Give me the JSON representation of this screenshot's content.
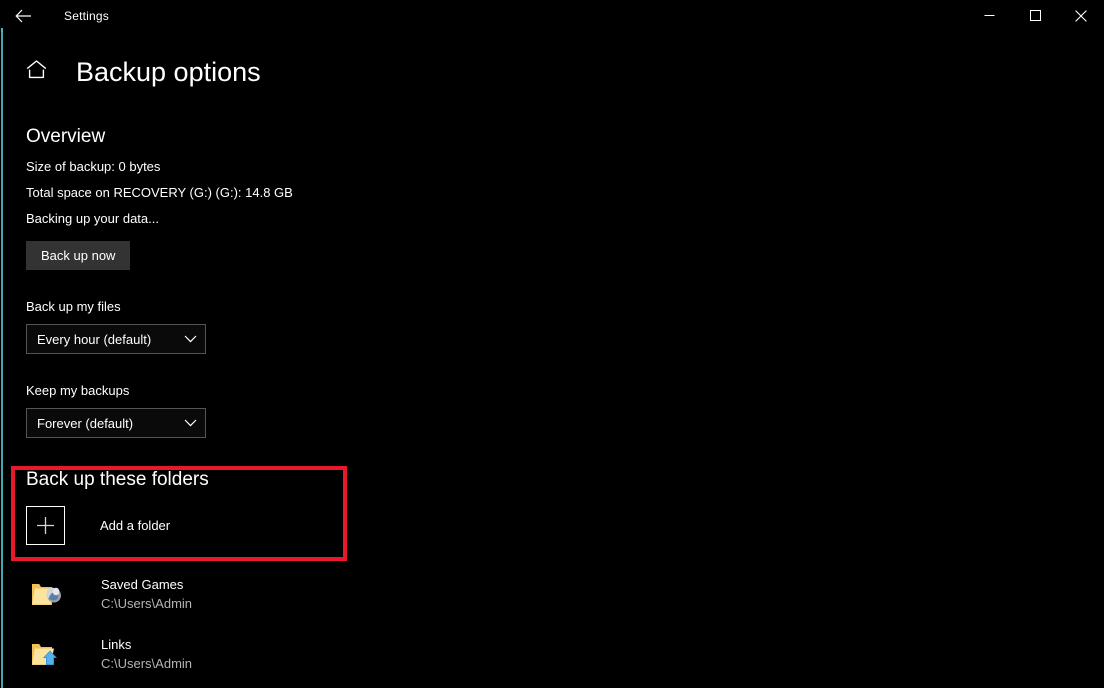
{
  "window": {
    "title": "Settings",
    "back_icon": "back-arrow-icon",
    "minimize_icon": "minimize-icon",
    "maximize_icon": "maximize-icon",
    "close_icon": "close-icon"
  },
  "header": {
    "home_icon": "home-icon",
    "page_title": "Backup options"
  },
  "overview": {
    "heading": "Overview",
    "size_of_backup": "Size of backup: 0 bytes",
    "total_space": "Total space on RECOVERY (G:) (G:): 14.8 GB",
    "status": "Backing up your data...",
    "backup_now_button": "Back up now"
  },
  "backup_files": {
    "label": "Back up my files",
    "selected": "Every hour (default)",
    "chevron_icon": "chevron-down-icon"
  },
  "keep_backups": {
    "label": "Keep my backups",
    "selected": "Forever (default)",
    "chevron_icon": "chevron-down-icon"
  },
  "folders": {
    "heading": "Back up these folders",
    "add_folder_label": "Add a folder",
    "plus_icon": "plus-icon",
    "highlight_color": "#e8192c",
    "items": [
      {
        "name": "Saved Games",
        "path": "C:\\Users\\Admin",
        "icon": "folder-saved-games-icon"
      },
      {
        "name": "Links",
        "path": "C:\\Users\\Admin",
        "icon": "folder-shortcut-icon"
      }
    ]
  },
  "theme": {
    "background": "#000000",
    "accent_stripe": "#4fc3cf",
    "button_fill": "#333333",
    "combo_border": "#555555",
    "secondary_text": "#b4b4b4"
  }
}
